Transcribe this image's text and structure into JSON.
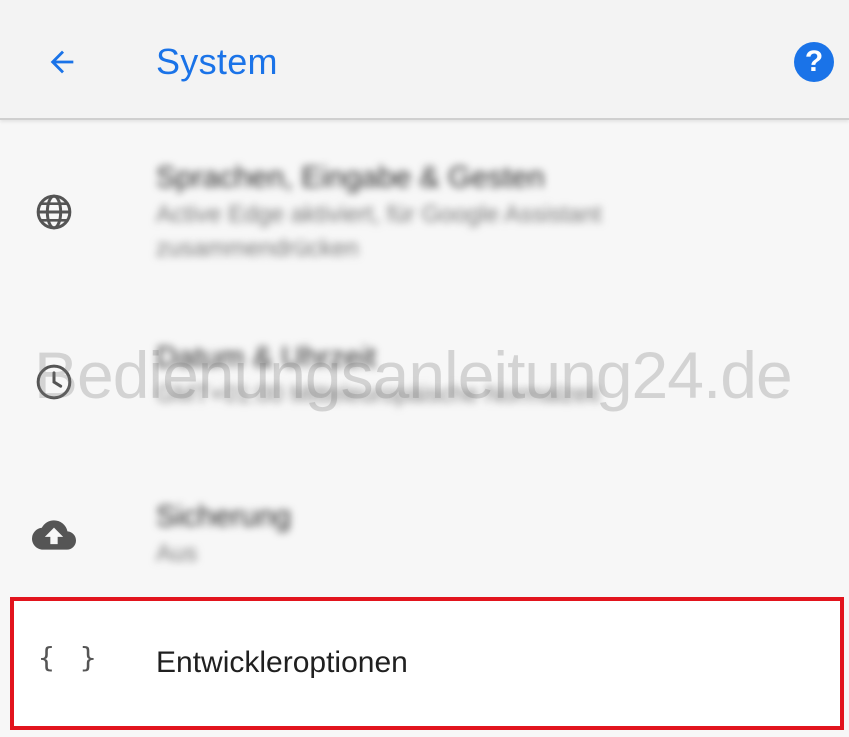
{
  "app_bar": {
    "title": "System",
    "back_icon": "arrow-back-icon",
    "help_icon": "help-icon",
    "help_glyph": "?",
    "accent_color": "#1a73e8"
  },
  "list": {
    "items": [
      {
        "icon": "globe-icon",
        "title": "Sprachen, Eingabe & Gesten",
        "summary": "Active Edge aktiviert, für Google Assistant zusammendrücken"
      },
      {
        "icon": "clock-icon",
        "title": "Datum & Uhrzeit",
        "summary": "GMT+01:00 Mitteleuropäische Normalzeit"
      },
      {
        "icon": "cloud-upload-icon",
        "title": "Sicherung",
        "summary": "Aus"
      }
    ],
    "highlighted": {
      "icon": "code-braces-icon",
      "icon_glyph": "{ }",
      "label": "Entwickleroptionen",
      "highlight_color": "#e2141d"
    }
  },
  "watermark": "Bedienungsanleitung24.de"
}
